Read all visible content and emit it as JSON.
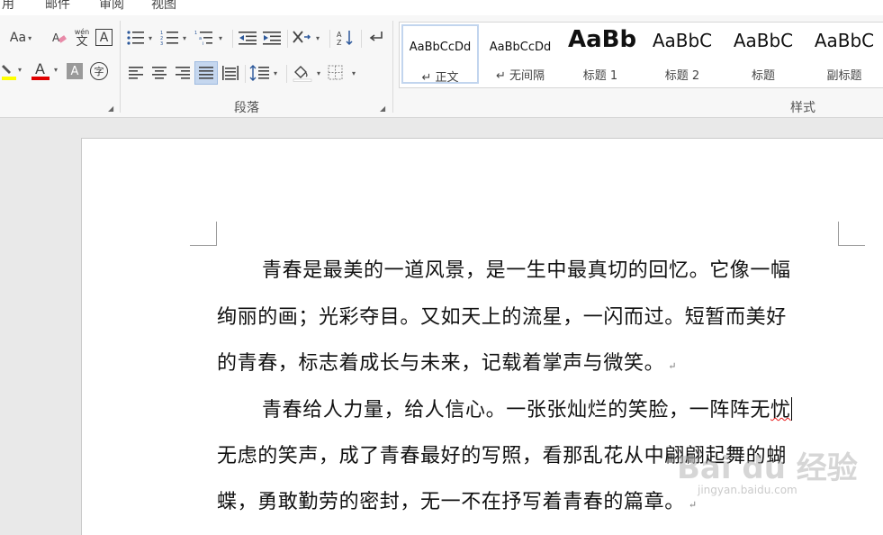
{
  "tabs": [
    "用",
    "邮件",
    "审阅",
    "视图"
  ],
  "ribbon": {
    "font": {
      "change_case": "Aa",
      "phonetic_top": "wén",
      "phonetic_bottom": "文",
      "border_char": "A",
      "font_color_char": "A",
      "shading_char": "A",
      "enclose_char": "字"
    },
    "groups": {
      "paragraph_label": "段落",
      "styles_label": "样式"
    },
    "styles": [
      {
        "preview": "AaBbCcDd",
        "name": "↵ 正文"
      },
      {
        "preview": "AaBbCcDd",
        "name": "↵ 无间隔"
      },
      {
        "preview": "AaBb",
        "name": "标题 1"
      },
      {
        "preview": "AaBbC",
        "name": "标题 2"
      },
      {
        "preview": "AaBbC",
        "name": "标题"
      },
      {
        "preview": "AaBbC",
        "name": "副标题"
      }
    ],
    "colors": {
      "highlight": "#ffff00",
      "font_color": "#e00000",
      "selected_style_border": "#c2d5ee"
    }
  },
  "document": {
    "lines": [
      "青春是最美的一道风景，是一生中最真切的回忆。它像一幅",
      "绚丽的画；光彩夺目。又如天上的流星，一闪而过。短暂而美好",
      "的青春，标志着成长与未来，记载着掌声与微笑。",
      "青春给人力量，给人信心。一张张灿烂的笑脸，一阵阵无",
      "忧",
      "无虑的笑声，成了青春最好的写照，看那乱花从中翩翩起舞的蝴",
      "蝶，勇敢勤劳的密封，无一不在抒写着青春的篇章。"
    ],
    "paragraph_mark": "↵"
  },
  "watermark": {
    "text": "Bai du 经验",
    "url": "jingyan.baidu.com"
  }
}
